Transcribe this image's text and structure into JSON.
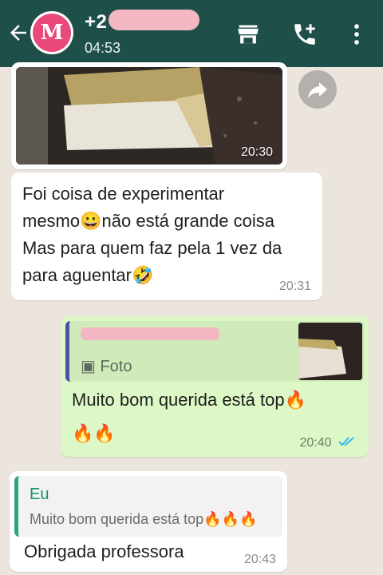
{
  "header": {
    "contact_name": "+2",
    "avatar_letter": "M",
    "status_time": "04:53",
    "icons": [
      "back-arrow-icon",
      "store-icon",
      "add-call-icon",
      "more-vertical-icon"
    ],
    "color": "#1f4f49"
  },
  "messages": [
    {
      "kind": "image",
      "direction": "incoming",
      "time": "20:30"
    },
    {
      "kind": "text",
      "direction": "incoming",
      "text": "Foi coisa de experimentar\nmesmo😀não está grande coisa\nMas para quem faz pela 1 vez da\npara aguentar🤣",
      "time": "20:31"
    },
    {
      "kind": "reply",
      "direction": "outgoing",
      "quote_label": "Foto",
      "text": "Muito bom querida está top🔥\n🔥🔥",
      "time": "20:40",
      "status": "read"
    },
    {
      "kind": "reply",
      "direction": "incoming",
      "quote_author": "Eu",
      "quote_text": "Muito bom querida está top🔥🔥🔥",
      "text": "Obrigada professora",
      "time": "20:43"
    }
  ],
  "colors": {
    "chat_bg": "#ece5dd",
    "incoming_bubble": "#ffffff",
    "outgoing_bubble": "#dcf8c6",
    "read_ticks": "#34b7f1"
  }
}
